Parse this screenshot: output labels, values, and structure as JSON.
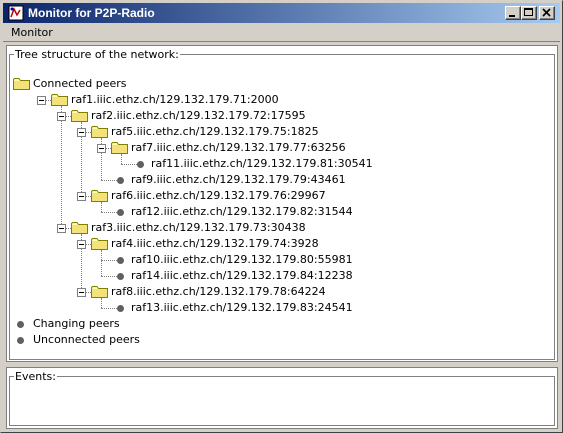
{
  "window": {
    "title": "Monitor for P2P-Radio"
  },
  "menu": {
    "items": [
      "Monitor"
    ]
  },
  "tree_panel": {
    "legend": "Tree structure of the network:",
    "root": "Connected peers",
    "nodes": [
      "raf1.iiic.ethz.ch/129.132.179.71:2000",
      "raf2.iiic.ethz.ch/129.132.179.72:17595",
      "raf5.iiic.ethz.ch/129.132.179.75:1825",
      "raf7.iiic.ethz.ch/129.132.179.77:63256",
      "raf11.iiic.ethz.ch/129.132.179.81:30541",
      "raf9.iiic.ethz.ch/129.132.179.79:43461",
      "raf6.iiic.ethz.ch/129.132.179.76:29967",
      "raf12.iiic.ethz.ch/129.132.179.82:31544",
      "raf3.iiic.ethz.ch/129.132.179.73:30438",
      "raf4.iiic.ethz.ch/129.132.179.74:3928",
      "raf10.iiic.ethz.ch/129.132.179.80:55981",
      "raf14.iiic.ethz.ch/129.132.179.84:12238",
      "raf8.iiic.ethz.ch/129.132.179.78:64224",
      "raf13.iiic.ethz.ch/129.132.179.83:24541"
    ],
    "other": [
      "Changing peers",
      "Unconnected peers"
    ]
  },
  "events_panel": {
    "legend": "Events:"
  }
}
